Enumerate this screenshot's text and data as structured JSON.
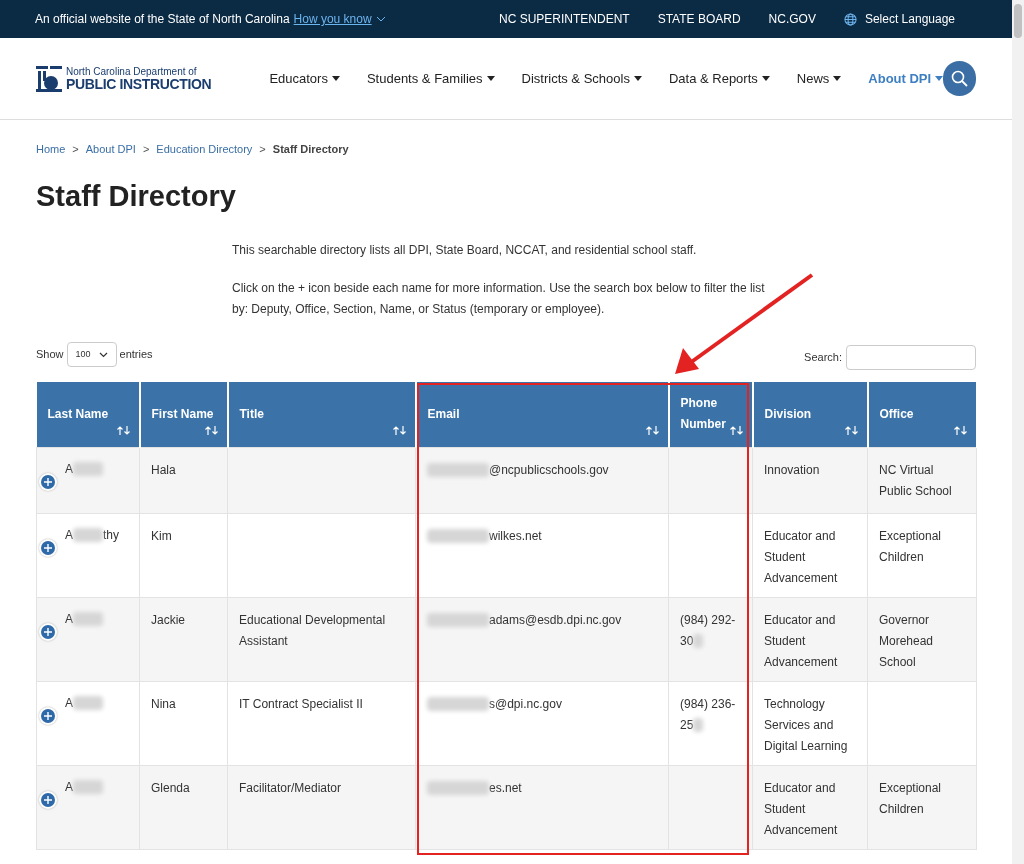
{
  "official_bar": {
    "text": "An official website of the State of North Carolina",
    "link": "How you know",
    "links": [
      "NC SUPERINTENDENT",
      "STATE BOARD",
      "NC.GOV"
    ],
    "language": "Select Language"
  },
  "logo": {
    "line1": "North Carolina Department of",
    "line2": "PUBLIC INSTRUCTION"
  },
  "nav": [
    {
      "label": "Educators",
      "selected": false
    },
    {
      "label": "Students & Families",
      "selected": false
    },
    {
      "label": "Districts & Schools",
      "selected": false
    },
    {
      "label": "Data & Reports",
      "selected": false
    },
    {
      "label": "News",
      "selected": false
    },
    {
      "label": "About DPI",
      "selected": true
    }
  ],
  "breadcrumbs": [
    {
      "label": "Home",
      "current": false
    },
    {
      "label": "About DPI",
      "current": false
    },
    {
      "label": "Education Directory",
      "current": false
    },
    {
      "label": "Staff Directory",
      "current": true
    }
  ],
  "breadcrumb_separator": ">",
  "title": "Staff Directory",
  "intro": [
    "This searchable directory lists all DPI, State Board, NCCAT, and residential school staff.",
    "Click on the + icon beside each name for more information.  Use the search box below to filter the list by: Deputy, Office, Section, Name, or Status (temporary or employee)."
  ],
  "length": {
    "before": "Show",
    "value": "100",
    "after": "entries"
  },
  "search": {
    "label": "Search:"
  },
  "table": {
    "columns": [
      "Last Name",
      "First Name",
      "Title",
      "Email",
      "Phone Number",
      "Division",
      "Office"
    ],
    "rows": [
      {
        "last_name": {
          "redacted": true,
          "visible": "A"
        },
        "first_name": "Hala",
        "email": {
          "redacted": true,
          "visible": "@ncpublicschools.gov"
        },
        "phone": {
          "redacted": false
        },
        "division": "Innovation",
        "office": "NC Virtual Public School"
      },
      {
        "last_name": {
          "redacted": true,
          "visible": "A",
          "tail": "thy"
        },
        "first_name": "Kim",
        "email": {
          "redacted": true,
          "visible": "wilkes.net"
        },
        "phone": {
          "redacted": false
        },
        "division": "Educator and Student Advancement",
        "office": "Exceptional Children"
      },
      {
        "last_name": {
          "redacted": true,
          "visible": "A"
        },
        "first_name": "Jackie",
        "title": "Educational Developmental Assistant",
        "email": {
          "redacted": true,
          "visible": "adams@esdb.dpi.nc.gov"
        },
        "phone": {
          "redacted": true,
          "visible": "(984) 292-30"
        },
        "division": "Educator and Student Advancement",
        "office": "Governor Morehead School"
      },
      {
        "last_name": {
          "redacted": true,
          "visible": "A"
        },
        "first_name": "Nina",
        "title": "IT Contract Specialist II",
        "email": {
          "redacted": true,
          "visible": "s@dpi.nc.gov"
        },
        "phone": {
          "redacted": true,
          "visible": "(984) 236-25"
        },
        "division": "Technology Services and Digital Learning"
      },
      {
        "last_name": {
          "redacted": true,
          "visible": "A"
        },
        "first_name": "Glenda",
        "title": "Facilitator/Mediator",
        "email": {
          "redacted": true,
          "visible": "es.net"
        },
        "phone": {
          "redacted": false
        },
        "division": "Educator and Student Advancement",
        "office": "Exceptional Children"
      }
    ]
  },
  "annotation": {
    "color": "#e32222"
  }
}
